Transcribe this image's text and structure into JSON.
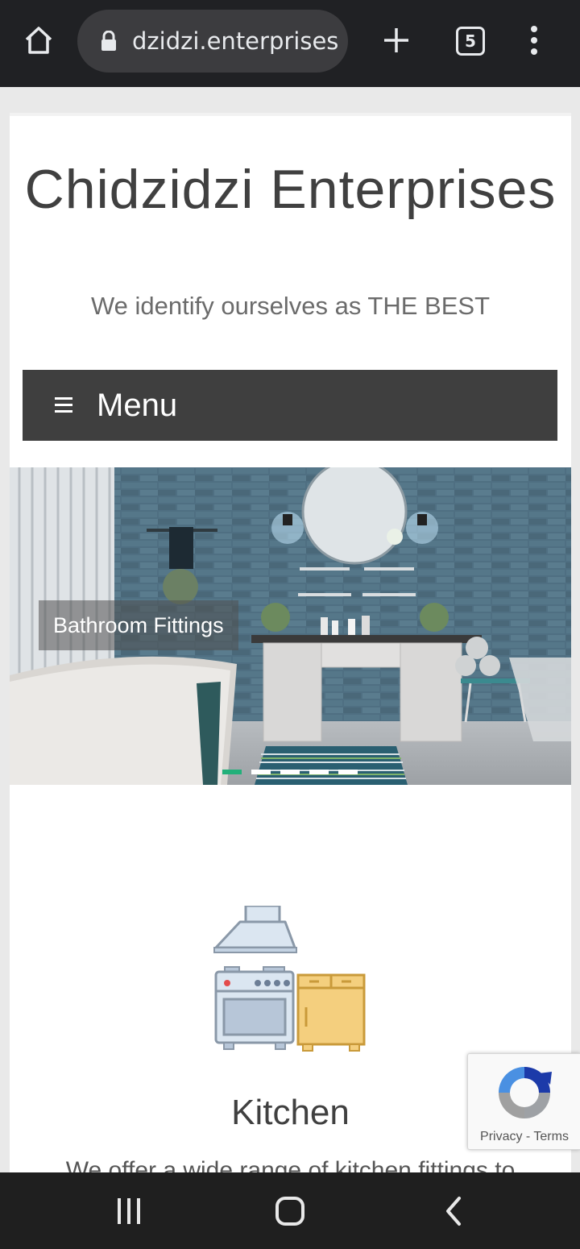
{
  "browser": {
    "url": "dzidzi.enterprises",
    "tab_count": "5",
    "icons": [
      "home-icon",
      "lock-icon",
      "plus-icon",
      "tab-switcher",
      "more-icon"
    ]
  },
  "site": {
    "title": "Chidzidzi Enterprises",
    "tagline": "We identify ourselves as THE BEST"
  },
  "menu": {
    "label": "Menu",
    "icon": "hamburger-icon"
  },
  "slider": {
    "caption": "Bathroom Fittings",
    "slide_count": 5,
    "active_index": 0,
    "accent_color": "#22b07a"
  },
  "feature": {
    "title": "Kitchen",
    "description": "We offer a wide range of kitchen fittings to"
  },
  "recaptcha": {
    "privacy": "Privacy",
    "separator": "-",
    "terms": "Terms"
  },
  "android_nav": {
    "icons": [
      "recent-apps-icon",
      "home-icon",
      "back-icon"
    ]
  }
}
